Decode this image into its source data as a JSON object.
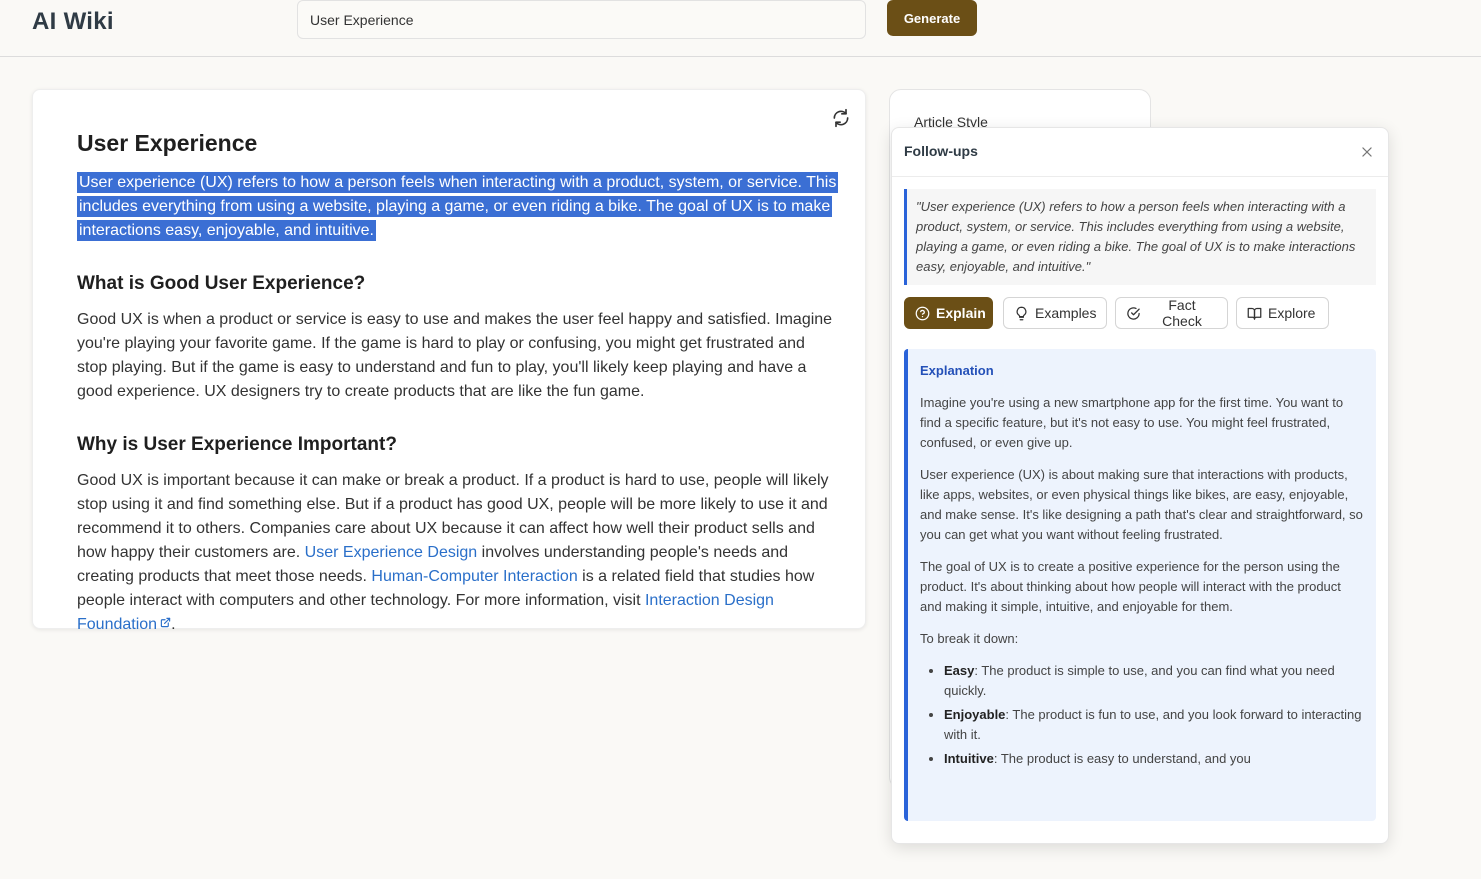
{
  "app": {
    "title": "AI Wiki"
  },
  "search": {
    "value": "User Experience"
  },
  "toolbar": {
    "generate_label": "Generate"
  },
  "article": {
    "title": "User Experience",
    "intro": "User experience (UX) refers to how a person feels when interacting with a product, system, or service. This includes everything from using a website, playing a game, or even riding a bike. The goal of UX is to make interactions easy, enjoyable, and intuitive.",
    "sections": [
      {
        "heading": "What is Good User Experience?",
        "body": "Good UX is when a product or service is easy to use and makes the user feel happy and satisfied. Imagine you're playing your favorite game. If the game is hard to play or confusing, you might get frustrated and stop playing. But if the game is easy to understand and fun to play, you'll likely keep playing and have a good experience. UX designers try to create products that are like the fun game."
      },
      {
        "heading": "Why is User Experience Important?",
        "body_1": "Good UX is important because it can make or break a product. If a product is hard to use, people will likely stop using it and find something else. But if a product has good UX, people will be more likely to use it and recommend it to others. Companies care about UX because it can affect how well their product sells and how happy their customers are.",
        "link_1": "User Experience Design",
        "body_2": "involves understanding people's needs and creating products that meet those needs.",
        "link_2": "Human-Computer Interaction",
        "body_3": "is a related field that studies how people interact with computers and other technology. For more information, visit",
        "link_3": "Interaction Design Foundation",
        "body_4": "."
      }
    ]
  },
  "style_panel": {
    "title": "Article Style"
  },
  "followups": {
    "title": "Follow-ups",
    "quote": "\"User experience (UX) refers to how a person feels when interacting with a product, system, or service. This includes everything from using a website, playing a game, or even riding a bike. The goal of UX is to make interactions easy, enjoyable, and intuitive.\"",
    "actions": [
      {
        "label": "Explain",
        "icon": "question-circle-icon",
        "active": true
      },
      {
        "label": "Examples",
        "icon": "lightbulb-icon"
      },
      {
        "label": "Fact Check",
        "icon": "check-circle-icon"
      },
      {
        "label": "Explore",
        "icon": "book-open-icon"
      }
    ],
    "explanation": {
      "heading": "Explanation",
      "paragraphs": [
        "Imagine you're using a new smartphone app for the first time. You want to find a specific feature, but it's not easy to use. You might feel frustrated, confused, or even give up.",
        "User experience (UX) is about making sure that interactions with products, like apps, websites, or even physical things like bikes, are easy, enjoyable, and make sense. It's like designing a path that's clear and straightforward, so you can get what you want without feeling frustrated.",
        "The goal of UX is to create a positive experience for the person using the product. It's about thinking about how people will interact with the product and making it simple, intuitive, and enjoyable for them.",
        "To break it down:"
      ],
      "bullets": [
        {
          "term": "Easy",
          "text": ": The product is simple to use, and you can find what you need quickly."
        },
        {
          "term": "Enjoyable",
          "text": ": The product is fun to use, and you look forward to interacting with it."
        },
        {
          "term": "Intuitive",
          "text": ": The product is easy to understand, and you"
        }
      ]
    }
  },
  "colors": {
    "accent_brown": "#6b4f16",
    "selection_blue": "#3b6fd4",
    "link_blue": "#2a6fc9",
    "explanation_bg": "#edf3fd"
  }
}
